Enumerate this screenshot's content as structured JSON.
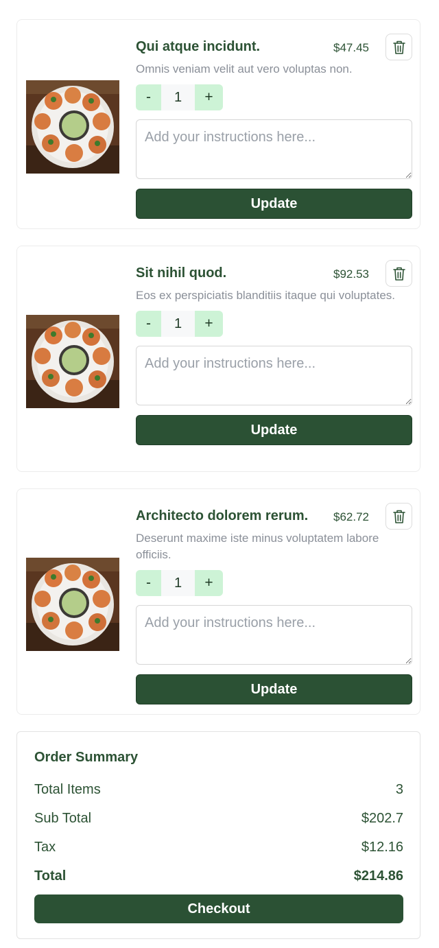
{
  "cart": {
    "items": [
      {
        "name": "Qui atque incidunt.",
        "price": "$47.45",
        "description": "Omnis veniam velit aut vero voluptas non.",
        "quantity": "1",
        "minus_label": "-",
        "plus_label": "+",
        "instructions_placeholder": "Add your instructions here...",
        "update_label": "Update",
        "image_alt": "plate of fried snacks with green chutney"
      },
      {
        "name": "Sit nihil quod.",
        "price": "$92.53",
        "description": "Eos ex perspiciatis blanditiis itaque qui voluptates.",
        "quantity": "1",
        "minus_label": "-",
        "plus_label": "+",
        "instructions_placeholder": "Add your instructions here...",
        "update_label": "Update",
        "image_alt": "plate of fried snacks with green chutney"
      },
      {
        "name": "Architecto dolorem rerum.",
        "price": "$62.72",
        "description": "Deserunt maxime iste minus voluptatem labore officiis.",
        "quantity": "1",
        "minus_label": "-",
        "plus_label": "+",
        "instructions_placeholder": "Add your instructions here...",
        "update_label": "Update",
        "image_alt": "plate of fried snacks with green chutney"
      }
    ],
    "delete_icon": "trash-icon"
  },
  "summary": {
    "title": "Order Summary",
    "total_items_label": "Total Items",
    "total_items_value": "3",
    "subtotal_label": "Sub Total",
    "subtotal_value": "$202.7",
    "tax_label": "Tax",
    "tax_value": "$12.16",
    "total_label": "Total",
    "total_value": "$214.86",
    "checkout_label": "Checkout"
  },
  "colors": {
    "brand_green": "#2b5134",
    "stepper_green": "#cdf3d6",
    "text_green": "#2c5234",
    "muted_text": "#8a8f98"
  }
}
